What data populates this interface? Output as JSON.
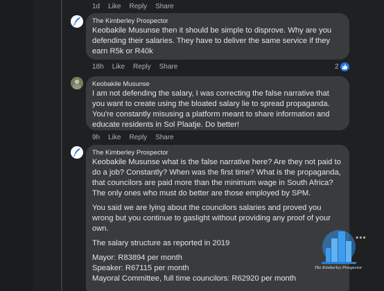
{
  "top_actions": {
    "time": "1d",
    "like": "Like",
    "reply": "Reply",
    "share": "Share"
  },
  "comments": [
    {
      "author": "The Kimberley Prospector",
      "mention": "Keobakile Musunse",
      "text": "then it should be simple to disprove. Why are you defending their salaries. They have to deliver the same service if they earn R5k or R40k",
      "time": "18h",
      "like": "Like",
      "reply": "Reply",
      "share": "Share",
      "reaction_count": "2"
    },
    {
      "author": "Keobakile Musunse",
      "text": "I am not defending the salary, I was correcting the false narrative that you want to create using the bloated salary lie to spread propaganda. You're constantly misusing a platform meant to share information and educate residents in Sol Plaatje. Do better!",
      "time": "9h",
      "like": "Like",
      "reply": "Reply",
      "share": "Share"
    },
    {
      "author": "The Kimberley Prospector",
      "mention": "Keobakile Musunse",
      "p1": "what is the false narrative here? Are they not paid to do a job? Constantly? When was the first time? What is the propaganda, that councilors are paid more than the minimum wage in South Africa? The only ones who must do better are those employed by SPM.",
      "p2": "You said we are lying about the councilors salaries and proved you wrong but you continue to gaslight without providing any proof of your own.",
      "p3": "The salary structure as reported in 2019",
      "line_mayor": "Mayor: R83894 per month",
      "line_speaker": "Speaker: R67115 per month",
      "line_mayoral": "Mayoral Committee, full time councilors: R62920 per month"
    }
  ],
  "watermark": {
    "caption": "The Kimberley Prospector"
  },
  "icons": {
    "brand_avatar": "quill-pen-icon",
    "person_avatar": "profile-photo",
    "like_reaction": "thumbs-up-icon",
    "more": "more-options-icon"
  },
  "colors": {
    "background": "#1f2021",
    "bubble": "#3a3b3c",
    "text": "#e4e6eb",
    "muted": "#b0b3b8",
    "like_blue": "#1877f2"
  }
}
